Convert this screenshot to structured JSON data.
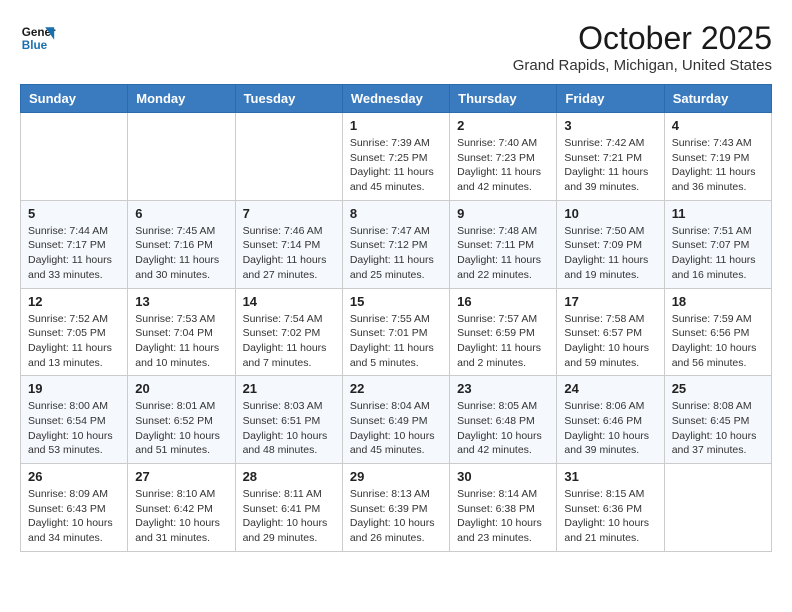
{
  "header": {
    "logo": {
      "line1": "General",
      "line2": "Blue"
    },
    "title": "October 2025",
    "location": "Grand Rapids, Michigan, United States"
  },
  "weekdays": [
    "Sunday",
    "Monday",
    "Tuesday",
    "Wednesday",
    "Thursday",
    "Friday",
    "Saturday"
  ],
  "weeks": [
    [
      {
        "day": "",
        "info": ""
      },
      {
        "day": "",
        "info": ""
      },
      {
        "day": "",
        "info": ""
      },
      {
        "day": "1",
        "info": "Sunrise: 7:39 AM\nSunset: 7:25 PM\nDaylight: 11 hours\nand 45 minutes."
      },
      {
        "day": "2",
        "info": "Sunrise: 7:40 AM\nSunset: 7:23 PM\nDaylight: 11 hours\nand 42 minutes."
      },
      {
        "day": "3",
        "info": "Sunrise: 7:42 AM\nSunset: 7:21 PM\nDaylight: 11 hours\nand 39 minutes."
      },
      {
        "day": "4",
        "info": "Sunrise: 7:43 AM\nSunset: 7:19 PM\nDaylight: 11 hours\nand 36 minutes."
      }
    ],
    [
      {
        "day": "5",
        "info": "Sunrise: 7:44 AM\nSunset: 7:17 PM\nDaylight: 11 hours\nand 33 minutes."
      },
      {
        "day": "6",
        "info": "Sunrise: 7:45 AM\nSunset: 7:16 PM\nDaylight: 11 hours\nand 30 minutes."
      },
      {
        "day": "7",
        "info": "Sunrise: 7:46 AM\nSunset: 7:14 PM\nDaylight: 11 hours\nand 27 minutes."
      },
      {
        "day": "8",
        "info": "Sunrise: 7:47 AM\nSunset: 7:12 PM\nDaylight: 11 hours\nand 25 minutes."
      },
      {
        "day": "9",
        "info": "Sunrise: 7:48 AM\nSunset: 7:11 PM\nDaylight: 11 hours\nand 22 minutes."
      },
      {
        "day": "10",
        "info": "Sunrise: 7:50 AM\nSunset: 7:09 PM\nDaylight: 11 hours\nand 19 minutes."
      },
      {
        "day": "11",
        "info": "Sunrise: 7:51 AM\nSunset: 7:07 PM\nDaylight: 11 hours\nand 16 minutes."
      }
    ],
    [
      {
        "day": "12",
        "info": "Sunrise: 7:52 AM\nSunset: 7:05 PM\nDaylight: 11 hours\nand 13 minutes."
      },
      {
        "day": "13",
        "info": "Sunrise: 7:53 AM\nSunset: 7:04 PM\nDaylight: 11 hours\nand 10 minutes."
      },
      {
        "day": "14",
        "info": "Sunrise: 7:54 AM\nSunset: 7:02 PM\nDaylight: 11 hours\nand 7 minutes."
      },
      {
        "day": "15",
        "info": "Sunrise: 7:55 AM\nSunset: 7:01 PM\nDaylight: 11 hours\nand 5 minutes."
      },
      {
        "day": "16",
        "info": "Sunrise: 7:57 AM\nSunset: 6:59 PM\nDaylight: 11 hours\nand 2 minutes."
      },
      {
        "day": "17",
        "info": "Sunrise: 7:58 AM\nSunset: 6:57 PM\nDaylight: 10 hours\nand 59 minutes."
      },
      {
        "day": "18",
        "info": "Sunrise: 7:59 AM\nSunset: 6:56 PM\nDaylight: 10 hours\nand 56 minutes."
      }
    ],
    [
      {
        "day": "19",
        "info": "Sunrise: 8:00 AM\nSunset: 6:54 PM\nDaylight: 10 hours\nand 53 minutes."
      },
      {
        "day": "20",
        "info": "Sunrise: 8:01 AM\nSunset: 6:52 PM\nDaylight: 10 hours\nand 51 minutes."
      },
      {
        "day": "21",
        "info": "Sunrise: 8:03 AM\nSunset: 6:51 PM\nDaylight: 10 hours\nand 48 minutes."
      },
      {
        "day": "22",
        "info": "Sunrise: 8:04 AM\nSunset: 6:49 PM\nDaylight: 10 hours\nand 45 minutes."
      },
      {
        "day": "23",
        "info": "Sunrise: 8:05 AM\nSunset: 6:48 PM\nDaylight: 10 hours\nand 42 minutes."
      },
      {
        "day": "24",
        "info": "Sunrise: 8:06 AM\nSunset: 6:46 PM\nDaylight: 10 hours\nand 39 minutes."
      },
      {
        "day": "25",
        "info": "Sunrise: 8:08 AM\nSunset: 6:45 PM\nDaylight: 10 hours\nand 37 minutes."
      }
    ],
    [
      {
        "day": "26",
        "info": "Sunrise: 8:09 AM\nSunset: 6:43 PM\nDaylight: 10 hours\nand 34 minutes."
      },
      {
        "day": "27",
        "info": "Sunrise: 8:10 AM\nSunset: 6:42 PM\nDaylight: 10 hours\nand 31 minutes."
      },
      {
        "day": "28",
        "info": "Sunrise: 8:11 AM\nSunset: 6:41 PM\nDaylight: 10 hours\nand 29 minutes."
      },
      {
        "day": "29",
        "info": "Sunrise: 8:13 AM\nSunset: 6:39 PM\nDaylight: 10 hours\nand 26 minutes."
      },
      {
        "day": "30",
        "info": "Sunrise: 8:14 AM\nSunset: 6:38 PM\nDaylight: 10 hours\nand 23 minutes."
      },
      {
        "day": "31",
        "info": "Sunrise: 8:15 AM\nSunset: 6:36 PM\nDaylight: 10 hours\nand 21 minutes."
      },
      {
        "day": "",
        "info": ""
      }
    ]
  ]
}
